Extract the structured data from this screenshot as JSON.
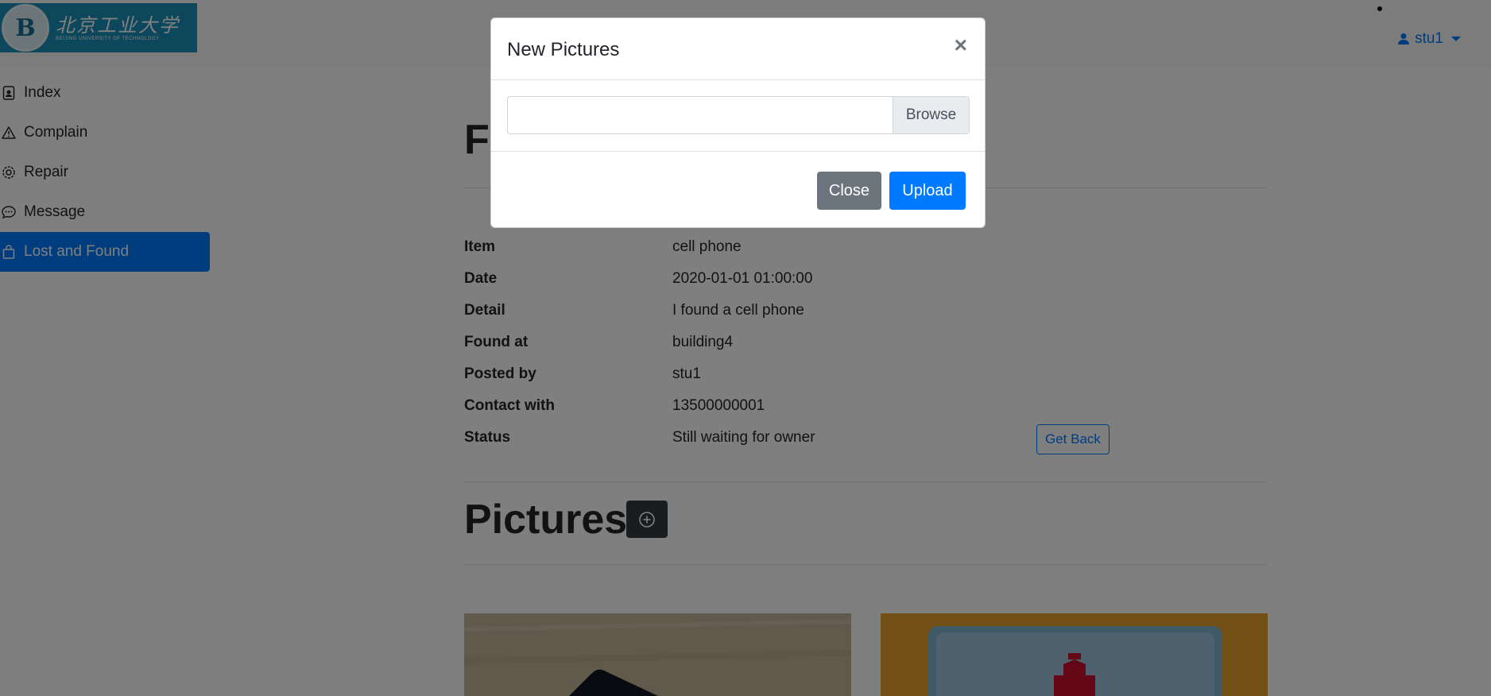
{
  "header": {
    "logo": {
      "cn_text": "北京工业大学",
      "en_text": "BEIJING UNIVERSITY OF TECHNOLOGY",
      "seal_letter": "B"
    },
    "user": {
      "name": "stu1",
      "icon": "user-icon"
    }
  },
  "sidebar": {
    "items": [
      {
        "label": "Index",
        "icon": "person-badge-icon"
      },
      {
        "label": "Complain",
        "icon": "warning-triangle-icon"
      },
      {
        "label": "Repair",
        "icon": "gear-icon"
      },
      {
        "label": "Message",
        "icon": "chat-dots-icon"
      },
      {
        "label": "Lost and Found",
        "icon": "bag-icon",
        "active": true
      }
    ]
  },
  "main": {
    "title_visible": "Fo",
    "details": [
      {
        "key": "Item",
        "value": "cell phone"
      },
      {
        "key": "Date",
        "value": "2020-01-01 01:00:00"
      },
      {
        "key": "Detail",
        "value": "I found a cell phone"
      },
      {
        "key": "Found at",
        "value": "building4"
      },
      {
        "key": "Posted by",
        "value": "stu1"
      },
      {
        "key": "Contact with",
        "value": "13500000001"
      },
      {
        "key": "Status",
        "value": "Still waiting for owner"
      }
    ],
    "get_back_label": "Get Back",
    "pictures_title": "Pictures",
    "add_picture_icon": "plus-circle-icon"
  },
  "modal": {
    "title": "New Pictures",
    "close_x": "×",
    "browse_label": "Browse",
    "file_input_value": "",
    "close_label": "Close",
    "upload_label": "Upload"
  },
  "colors": {
    "primary": "#007bff",
    "secondary": "#6c757d",
    "dark": "#343a40",
    "backdrop": "rgba(0,0,0,0.5)"
  }
}
